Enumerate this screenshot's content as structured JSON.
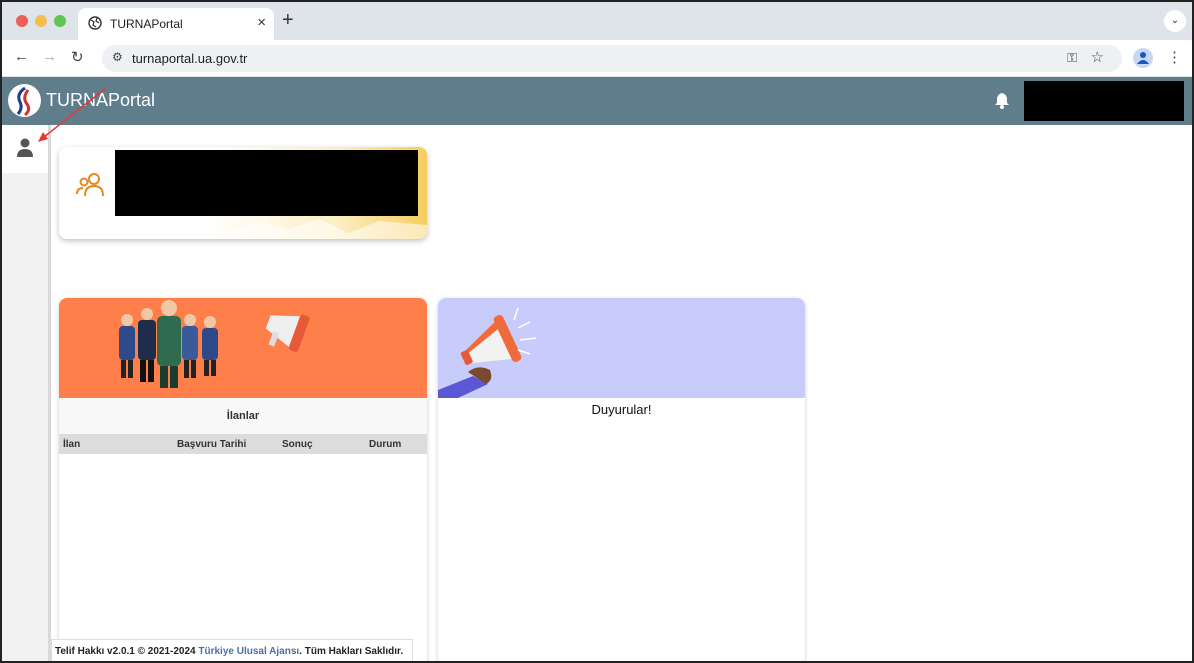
{
  "browser": {
    "tab_title": "TURNAPortal",
    "tab_close": "×",
    "new_tab": "+",
    "url": "turnaportal.ua.gov.tr"
  },
  "header": {
    "app_title": "TURNAPortal"
  },
  "cards": {
    "ilanlar": {
      "title": "İlanlar",
      "columns": [
        "İlan",
        "Başvuru Tarihi",
        "Sonuç",
        "Durum"
      ]
    },
    "duyurular": {
      "title": "Duyurular!"
    }
  },
  "footer": {
    "prefix": "Telif Hakkı v2.0.1 © 2021-2024 ",
    "link": "Türkiye Ulusal Ajansı",
    "suffix": ". Tüm Hakları Saklıdır."
  },
  "colors": {
    "header_bg": "#607d8b",
    "orange_banner": "#ff7f4a",
    "lilac_banner": "#c7ccfb",
    "annotation_arrow": "#e53935"
  }
}
